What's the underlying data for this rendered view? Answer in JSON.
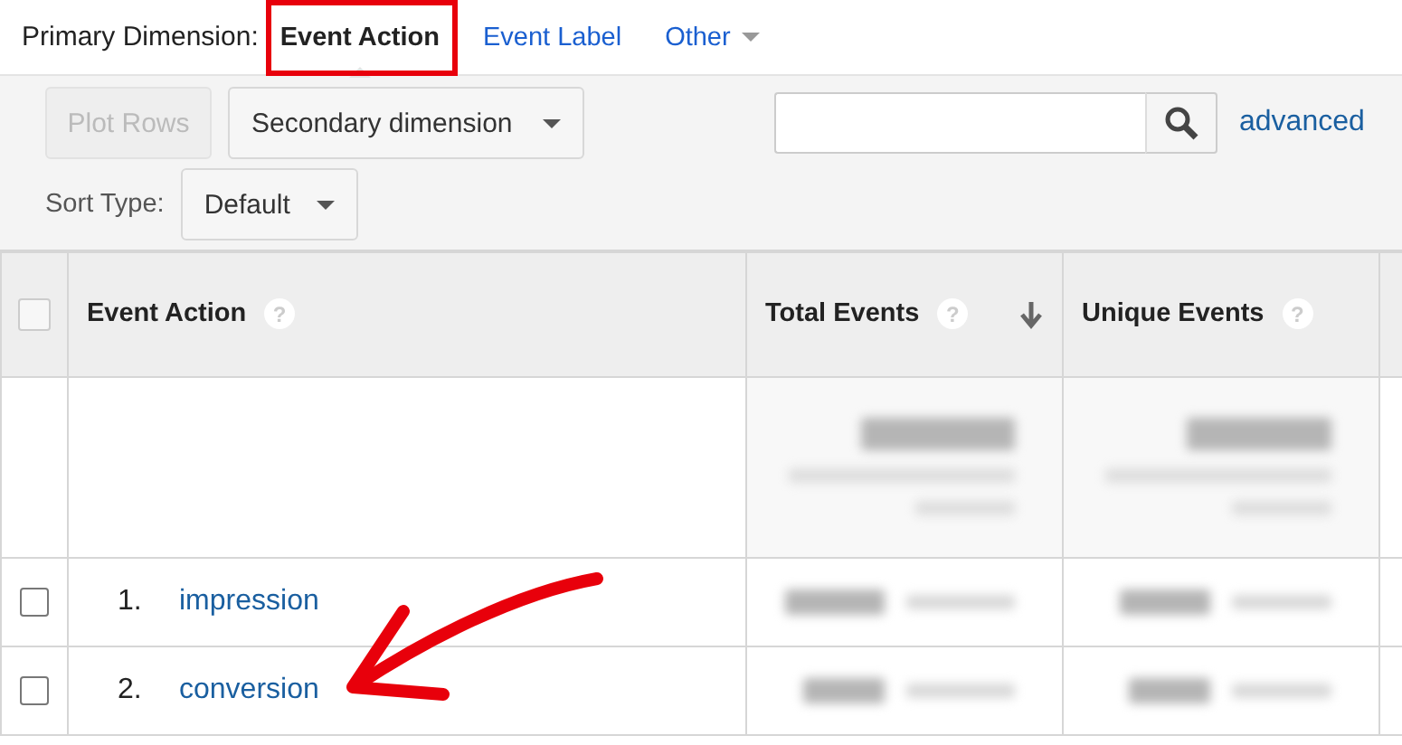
{
  "primary_dimension": {
    "label": "Primary Dimension:",
    "options": [
      {
        "label": "Event Action",
        "selected": true,
        "highlighted": true,
        "kind": "link"
      },
      {
        "label": "Event Label",
        "selected": false,
        "highlighted": false,
        "kind": "link"
      },
      {
        "label": "Other",
        "selected": false,
        "highlighted": false,
        "kind": "dropdown"
      }
    ]
  },
  "toolbar": {
    "plot_rows": {
      "label": "Plot Rows",
      "disabled": true
    },
    "secondary_dimension": "Secondary dimension",
    "advanced": "advanced",
    "sort_type": {
      "label": "Sort Type:",
      "value": "Default"
    }
  },
  "table": {
    "select_all": {
      "checked": false
    },
    "columns": [
      {
        "label": "Event Action",
        "help": "?",
        "sorted": false
      },
      {
        "label": "Total Events",
        "help": "?",
        "sorted": true
      },
      {
        "label": "Unique Events",
        "help": "?",
        "sorted": false
      }
    ],
    "rows": [
      {
        "index": "1.",
        "label": "impression",
        "checked": false,
        "pointed_at": false
      },
      {
        "index": "2.",
        "label": "conversion",
        "checked": false,
        "pointed_at": true
      }
    ]
  }
}
